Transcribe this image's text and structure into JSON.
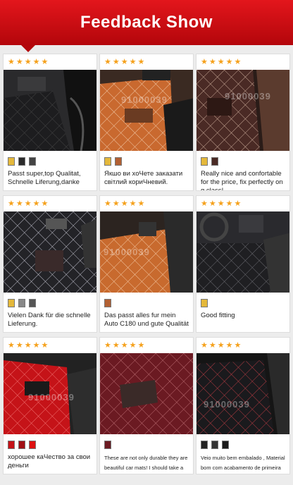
{
  "header": {
    "title": "Feedback Show"
  },
  "colors": {
    "accent": "#d40d13",
    "star": "#f5a11c"
  },
  "reviews": [
    {
      "stars": 5,
      "caption": "Passt super,top Qualitat, Schnelle Liferung,danke",
      "mat_color": "black"
    },
    {
      "stars": 5,
      "caption": "Якшо ви хоЧете заказати світлий кориЧневий.",
      "mat_color": "orange-tan"
    },
    {
      "stars": 5,
      "caption": "Really nice and confortable for the price, fix perfectly on g class!",
      "mat_color": "dark-brown"
    },
    {
      "stars": 5,
      "caption": "Vielen Dank für die schnelle Lieferung.",
      "mat_color": "black"
    },
    {
      "stars": 5,
      "caption": "Das passt alles fur mein Auto C180 und gute Qualität",
      "mat_color": "orange-tan"
    },
    {
      "stars": 5,
      "caption": "Good fitting",
      "mat_color": "black"
    },
    {
      "stars": 5,
      "caption": "хорошее каЧество за свои деньги",
      "mat_color": "red"
    },
    {
      "stars": 5,
      "caption": "These are not only durable they are beautiful car mats! I should take a picture.",
      "mat_color": "wine-red"
    },
    {
      "stars": 5,
      "caption": "Veio muito bem embalado , Material bom com acabamento de primeira",
      "mat_color": "black-red"
    }
  ],
  "watermark": "91000039"
}
